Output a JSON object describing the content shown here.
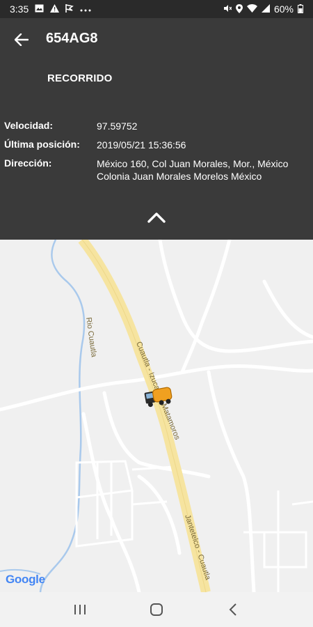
{
  "status_bar": {
    "time": "3:35",
    "battery": "60%",
    "left_icons": [
      "image-icon",
      "alert-icon",
      "flag-icon",
      "more-icon"
    ],
    "right_icons": [
      "mute-icon",
      "location-icon",
      "wifi-icon",
      "signal-icon",
      "battery-icon"
    ]
  },
  "header": {
    "title": "654AG8",
    "recorrido_label": "RECORRIDO",
    "info": [
      {
        "label": "Velocidad:",
        "value": "97.59752"
      },
      {
        "label": "Última posición:",
        "value": "2019/05/21 15:36:56"
      },
      {
        "label": "Dirección:",
        "value": "México 160, Col Juan Morales, Mor., México Colonia Juan Morales Morelos México"
      }
    ]
  },
  "map": {
    "road_labels": [
      "Cuautla - Izucar de Matamoros",
      "Jantetelco - Cuautla",
      "Rio Cuautla"
    ],
    "logo": "Google",
    "vehicle_icon": "truck-icon",
    "colors": {
      "highway": "#f6e4a0",
      "river": "#a9c9ec",
      "road": "#ffffff",
      "background": "#f0f0f0"
    }
  },
  "nav_bar": {
    "buttons": [
      "recents-icon",
      "home-icon",
      "back-icon"
    ]
  }
}
